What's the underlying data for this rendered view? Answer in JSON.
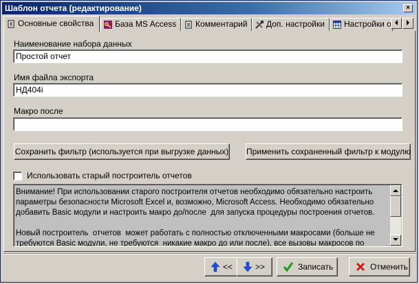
{
  "window": {
    "title": "Шаблон отчета (редактирование)",
    "close_glyph": "×"
  },
  "tabs": [
    {
      "label": "Основные свойства",
      "icon": "document-icon"
    },
    {
      "label": "База MS Access",
      "icon": "key-icon"
    },
    {
      "label": "Комментарий",
      "icon": "document-icon"
    },
    {
      "label": "Доп. настройки",
      "icon": "tools-icon"
    },
    {
      "label": "Настройки от",
      "icon": "grid-icon"
    }
  ],
  "form": {
    "dataset_name_label": "Наименование набора данных",
    "dataset_name_value": "Простой отчет",
    "export_file_label": "Имя файла экспорта",
    "export_file_value": "НД404i",
    "macro_after_label": "Макро после",
    "macro_after_value": "",
    "save_filter_label": "Сохранить фильтр (используется при выгрузке данных)",
    "apply_filter_label": "Применить сохраненный фильтр к модулю",
    "old_builder_label": "Использовать старый построитель отчетов",
    "old_builder_checked": false,
    "note": "Внимание! При использовании старого построителя отчетов необходимо обязательно настроить параметры безопасности Microsoft Excel и, возможно, Microsoft Access. Необходимо обязательно добавить Basic модули и настроить макро до/после  для запуска процедуры построения отчетов.\n\nНовый построитель  отчетов  может работать с полностью отключенными макросами (больше не требуются Basic модули, не требуются  никакие макро до или после), все вызовы макросов по умолчанию"
  },
  "footer": {
    "prev_label": "<<",
    "next_label": ">>",
    "save_label": "Записать",
    "cancel_label": "Отменить"
  },
  "colors": {
    "title_start": "#0a246a",
    "title_end": "#a6caf0",
    "face": "#d4d0c8",
    "arrow_blue": "#1e4fd8",
    "check_green": "#1a9a1a",
    "cancel_red": "#c81e1e"
  }
}
